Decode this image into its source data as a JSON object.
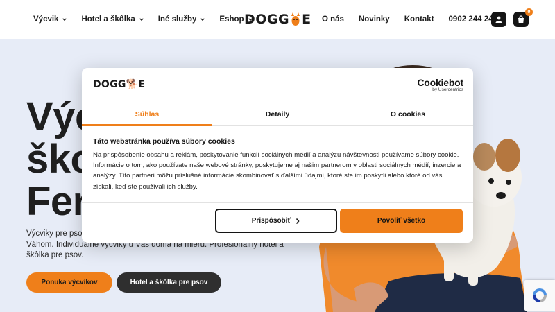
{
  "header": {
    "nav_left": [
      {
        "label": "Výcvik"
      },
      {
        "label": "Hotel a škôlka"
      },
      {
        "label": "Iné služby"
      },
      {
        "label": "Eshop"
      }
    ],
    "logo": {
      "prefix": "DOGG",
      "suffix": "E"
    },
    "nav_right": [
      {
        "label": "O nás"
      },
      {
        "label": "Novinky"
      },
      {
        "label": "Kontakt"
      },
      {
        "label": "0902 244 244"
      }
    ],
    "account_icon": "user-icon",
    "cart_icon": "shopping-bag-icon",
    "cart_count": "0"
  },
  "hero": {
    "title_lines": [
      "Výc",
      "škol",
      "Ferl"
    ],
    "description": "Výcviky pre psov mestách Bratislava, Pezinok, Nitra, Nové Mesto nad Váhom. Individuálne výcviky u Vás doma na mieru. Profesionálny hotel a škôlka pre psov.",
    "primary_button": "Ponuka výcvikov",
    "secondary_button": "Hotel a škôlka pre psov"
  },
  "cookie_dialog": {
    "logo": {
      "prefix": "DOGG",
      "suffix": "E"
    },
    "brand_name": "Cookiebot",
    "brand_sub": "by Usercentrics",
    "tabs": [
      {
        "label": "Súhlas",
        "active": true
      },
      {
        "label": "Detaily",
        "active": false
      },
      {
        "label": "O cookies",
        "active": false
      }
    ],
    "heading": "Táto webstránka používa súbory cookies",
    "body": "Na prispôsobenie obsahu a reklám, poskytovanie funkcií sociálnych médií a analýzu návštevnosti používame súbory cookie. Informácie o tom, ako používate naše webové stránky, poskytujeme aj našim partnerom v oblasti sociálnych médií, inzercie a analýzy. Títo partneri môžu príslušné informácie skombinovať s ďalšími údajmi, ktoré ste im poskytli alebo ktoré od vás získali, keď ste používali ich služby.",
    "customize_button": "Prispôsobiť",
    "allow_all_button": "Povoliť všetko"
  },
  "colors": {
    "accent": "#ef7f1a",
    "dark": "#2f2f2f",
    "background": "#e7ecf7"
  }
}
